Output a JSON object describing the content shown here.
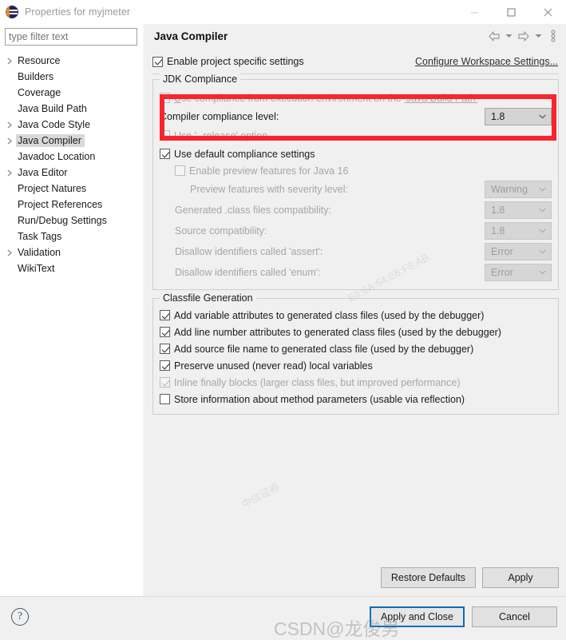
{
  "window": {
    "title": "Properties for myjmeter",
    "icon": "eclipse-icon",
    "controls": {
      "minimize": "minimize-icon",
      "maximize": "maximize-icon",
      "close": "close-icon"
    }
  },
  "sidebar": {
    "filter": {
      "placeholder": "type filter text",
      "value": ""
    },
    "items": [
      {
        "label": "Resource",
        "expandable": true,
        "selected": false
      },
      {
        "label": "Builders",
        "expandable": false,
        "selected": false
      },
      {
        "label": "Coverage",
        "expandable": false,
        "selected": false
      },
      {
        "label": "Java Build Path",
        "expandable": false,
        "selected": false
      },
      {
        "label": "Java Code Style",
        "expandable": true,
        "selected": false
      },
      {
        "label": "Java Compiler",
        "expandable": true,
        "selected": true
      },
      {
        "label": "Javadoc Location",
        "expandable": false,
        "selected": false
      },
      {
        "label": "Java Editor",
        "expandable": true,
        "selected": false
      },
      {
        "label": "Project Natures",
        "expandable": false,
        "selected": false
      },
      {
        "label": "Project References",
        "expandable": false,
        "selected": false
      },
      {
        "label": "Run/Debug Settings",
        "expandable": false,
        "selected": false
      },
      {
        "label": "Task Tags",
        "expandable": false,
        "selected": false
      },
      {
        "label": "Validation",
        "expandable": true,
        "selected": false
      },
      {
        "label": "WikiText",
        "expandable": false,
        "selected": false
      }
    ]
  },
  "panel": {
    "title": "Java Compiler",
    "nav": {
      "back": "back-arrow-icon",
      "back_menu": "chevron-down-icon",
      "forward": "forward-arrow-icon",
      "forward_menu": "chevron-down-icon",
      "view_menu": "vertical-dots-icon"
    },
    "enable_project_specific": {
      "label": "Enable project specific settings",
      "checked": true,
      "enabled": true
    },
    "workspace_link": "Configure Workspace Settings...",
    "jdk_compliance": {
      "title": "JDK Compliance",
      "use_execution_env": {
        "label_prefix": "U",
        "label_mid": "se compliance from execution environment on the ",
        "label_link": "'Java Build Path'",
        "checked": false,
        "enabled": false
      },
      "compliance_level": {
        "label": "Compiler compliance level:",
        "value": "1.8",
        "enabled": true
      },
      "use_release_option": {
        "label": "Use '--release' option",
        "checked": false,
        "enabled": false
      },
      "use_default_compliance": {
        "label": "Use default compliance settings",
        "checked": true,
        "enabled": true
      },
      "enable_preview": {
        "label": "Enable preview features for Java 16",
        "checked": false,
        "enabled": false
      },
      "preview_severity": {
        "label": "Preview features with severity level:",
        "value": "Warning",
        "enabled": false
      },
      "generated_class_compat": {
        "label": "Generated .class files compatibility:",
        "value": "1.8",
        "enabled": false
      },
      "source_compat": {
        "label": "Source compatibility:",
        "value": "1.8",
        "enabled": false
      },
      "disallow_assert": {
        "label": "Disallow identifiers called 'assert':",
        "value": "Error",
        "enabled": false
      },
      "disallow_enum": {
        "label": "Disallow identifiers called 'enum':",
        "value": "Error",
        "enabled": false
      }
    },
    "classfile_generation": {
      "title": "Classfile Generation",
      "options": [
        {
          "label": "Add variable attributes to generated class files (used by the debugger)",
          "checked": true,
          "enabled": true
        },
        {
          "label": "Add line number attributes to generated class files (used by the debugger)",
          "checked": true,
          "enabled": true
        },
        {
          "label": "Add source file name to generated class file (used by the debugger)",
          "checked": true,
          "enabled": true
        },
        {
          "label": "Preserve unused (never read) local variables",
          "checked": true,
          "enabled": true
        },
        {
          "label": "Inline finally blocks (larger class files, but improved performance)",
          "checked": true,
          "enabled": false
        },
        {
          "label": "Store information about method parameters (usable via reflection)",
          "checked": false,
          "enabled": true
        }
      ]
    },
    "buttons": {
      "restore_defaults": "Restore Defaults",
      "apply": "Apply"
    }
  },
  "footer": {
    "help": "help-icon",
    "apply_and_close": "Apply and Close",
    "cancel": "Cancel"
  },
  "overlay": {
    "highlight_color": "#f9242c",
    "watermark_csdn": "CSDN@龙俊男"
  }
}
